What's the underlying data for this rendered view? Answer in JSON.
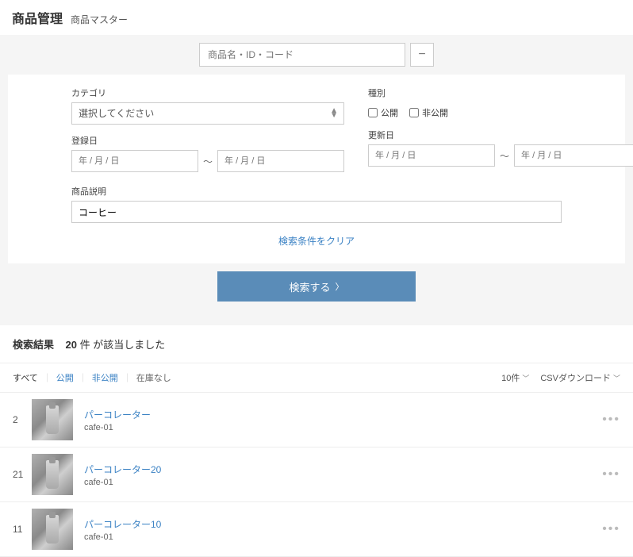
{
  "header": {
    "title": "商品管理",
    "subtitle": "商品マスター"
  },
  "search": {
    "keyword_placeholder": "商品名・ID・コード",
    "toggle_icon": "−",
    "category_label": "カテゴリ",
    "category_selected": "選択してください",
    "disclosure_label": "種別",
    "public_label": "公開",
    "private_label": "非公開",
    "reg_date_label": "登録日",
    "upd_date_label": "更新日",
    "date_placeholder": "年 / 月 / 日",
    "tilde": "〜",
    "desc_label": "商品説明",
    "desc_value": "コーヒー",
    "clear_label": "検索条件をクリア",
    "submit_label": "検索する"
  },
  "results": {
    "header_label": "検索結果",
    "count": "20",
    "count_unit": "件",
    "count_suffix": "が該当しました",
    "filter_all": "すべて",
    "filter_public": "公開",
    "filter_private": "非公開",
    "filter_outofstock": "在庫なし",
    "per_page": "10件",
    "csv_label": "CSVダウンロード",
    "rows": [
      {
        "id": "2",
        "name": "パーコレーター",
        "code": "cafe-01"
      },
      {
        "id": "21",
        "name": "パーコレーター20",
        "code": "cafe-01"
      },
      {
        "id": "11",
        "name": "パーコレーター10",
        "code": "cafe-01"
      }
    ]
  }
}
